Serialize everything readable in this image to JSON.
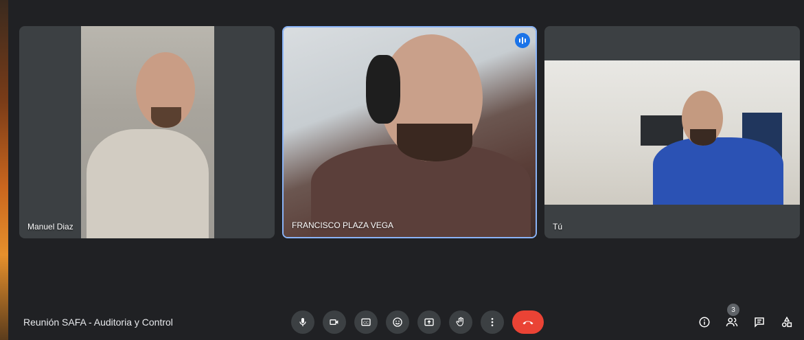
{
  "tiles": [
    {
      "name": "Manuel Diaz"
    },
    {
      "name": "FRANCISCO PLAZA VEGA"
    },
    {
      "name": "Tú"
    }
  ],
  "meeting": {
    "title": "Reunión SAFA - Auditoria y Control"
  },
  "participants": {
    "count": "3"
  },
  "colors": {
    "accent": "#8ab4f8",
    "end_call": "#ea4335",
    "control_bg": "#3c4043",
    "background": "#202124"
  },
  "icons": {
    "controls": [
      "microphone-icon",
      "camera-icon",
      "captions-icon",
      "emoji-icon",
      "present-screen-icon",
      "raise-hand-icon",
      "more-options-icon",
      "end-call-icon"
    ],
    "right": [
      "info-icon",
      "people-icon",
      "chat-icon",
      "activities-icon"
    ]
  }
}
